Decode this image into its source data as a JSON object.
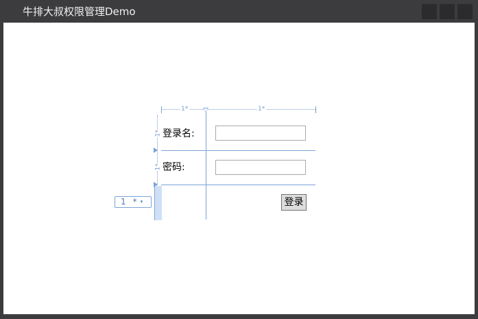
{
  "window": {
    "title": "牛排大叔权限管理Demo"
  },
  "designer": {
    "column_sizes": [
      "1*",
      "1*"
    ],
    "row_sizes": [
      "1*",
      "1*",
      "1*"
    ],
    "row_chip": {
      "value": "1",
      "unit": "*",
      "caret": "▾"
    }
  },
  "form": {
    "username_label": "登录名:",
    "username_value": "",
    "password_label": "密码:",
    "password_value": "",
    "login_button": "登录"
  },
  "colors": {
    "titlebar": "#3c3c3f",
    "title_text": "#f1f1f1",
    "client_bg": "#ffffff",
    "adorner": "#7aa3d6"
  }
}
